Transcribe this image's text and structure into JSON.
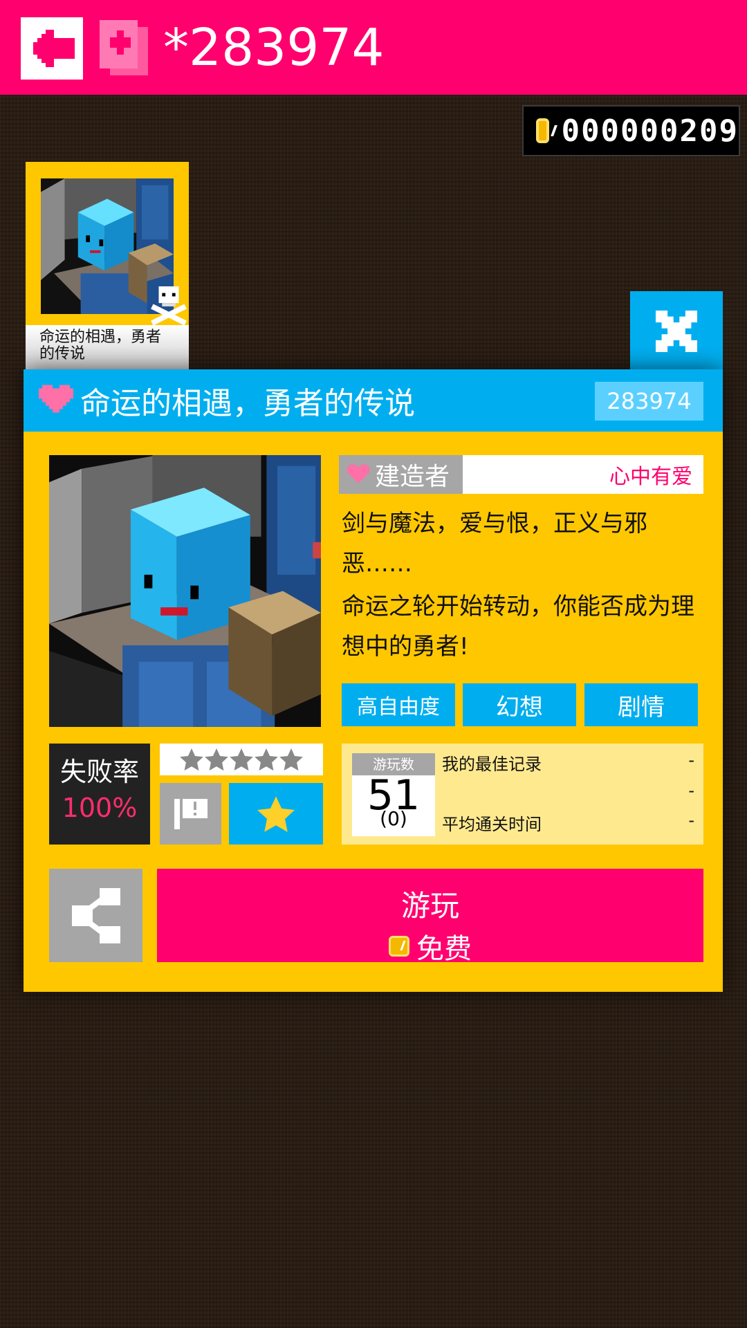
{
  "topbar": {
    "title": "*283974",
    "back_icon": "back-arrow-icon",
    "page_icon": "copy-page-icon",
    "bg_color": "#ff006e"
  },
  "coins": {
    "value": "000000209",
    "icon": "coin-icon"
  },
  "mini_card": {
    "label": "命运的相遇，勇者的传说",
    "badge_icon": "skull-icon"
  },
  "close_icon": "close-icon",
  "level": {
    "title": "命运的相遇，勇者的传说",
    "id": "283974",
    "creator_tag": "建造者",
    "creator_name": "心中有爱",
    "description_1": "剑与魔法，爱与恨，正义与邪恶……",
    "description_2": "命运之轮开始转动，你能否成为理想中的勇者!",
    "tags": [
      "高自由度",
      "幻想",
      "剧情"
    ]
  },
  "stats": {
    "fail_label": "失败率",
    "fail_value": "100%",
    "rating_stars": 0,
    "plays_label": "游玩数",
    "plays_value": "51",
    "plays_sub": "(0)",
    "best_label": "我的最佳记录",
    "best_value": "-",
    "row2_value": "-",
    "avg_label": "平均通关时间",
    "avg_value": "-"
  },
  "actions": {
    "share_icon": "share-icon",
    "report_icon": "report-flag-icon",
    "favorite_icon": "star-icon",
    "play_label": "游玩",
    "play_cost": "免费"
  },
  "colors": {
    "accent_pink": "#ff006e",
    "accent_blue": "#00aeef",
    "panel_yellow": "#ffc700"
  }
}
